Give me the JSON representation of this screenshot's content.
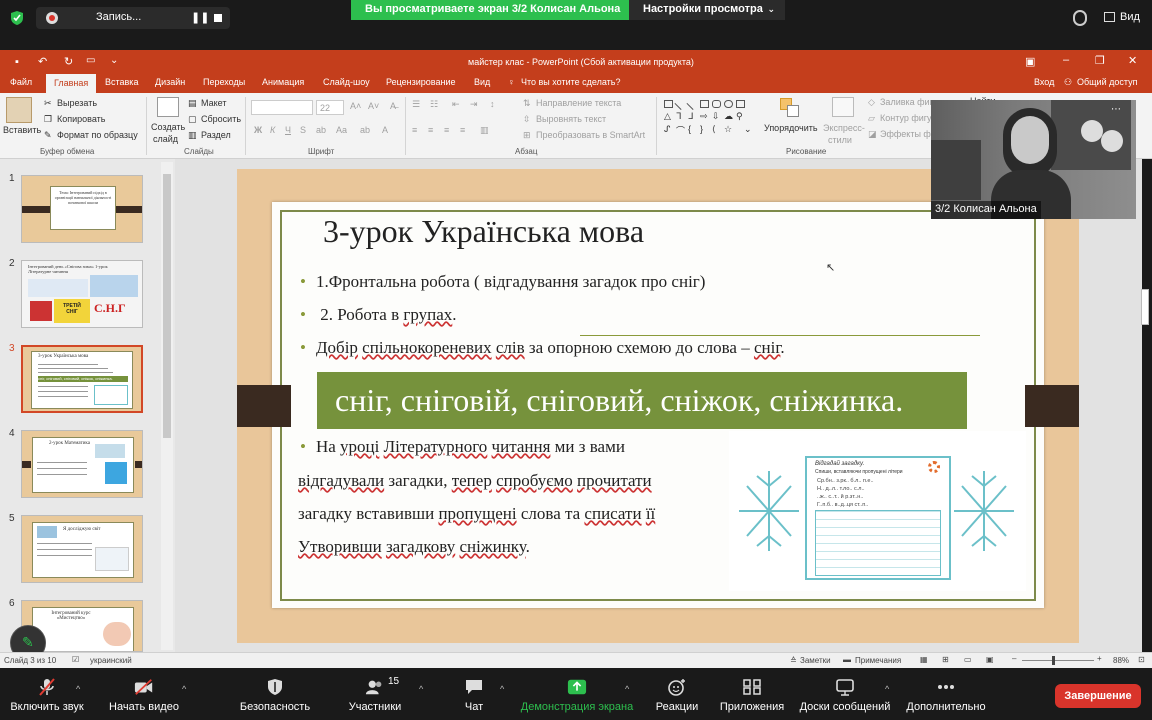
{
  "zoom": {
    "recording_label": "Запись...",
    "sharing_banner": "Вы просматриваете экран 3/2 Колисан Альона",
    "view_options": "Настройки просмотра",
    "view_label": "Вид",
    "participant_count": "15",
    "toolbar": [
      {
        "id": "mute",
        "label": "Включить звук"
      },
      {
        "id": "video",
        "label": "Начать видео"
      },
      {
        "id": "security",
        "label": "Безопасность"
      },
      {
        "id": "participants",
        "label": "Участники"
      },
      {
        "id": "chat",
        "label": "Чат"
      },
      {
        "id": "share",
        "label": "Демонстрация экрана"
      },
      {
        "id": "reactions",
        "label": "Реакции"
      },
      {
        "id": "apps",
        "label": "Приложения"
      },
      {
        "id": "whiteboards",
        "label": "Доски сообщений"
      },
      {
        "id": "more",
        "label": "Дополнительно"
      }
    ],
    "end_button": "Завершение",
    "video_name": "3/2 Колисан Альона",
    "share_color": "#2dbf4e",
    "end_color": "#d9342b"
  },
  "ppt": {
    "window_title": "майстер клас - PowerPoint (Сбой активации продукта)",
    "tabs": [
      "Файл",
      "Главная",
      "Вставка",
      "Дизайн",
      "Переходы",
      "Анимация",
      "Слайд-шоу",
      "Рецензирование",
      "Вид"
    ],
    "tell_me": "Что вы хотите сделать?",
    "signin": "Вход",
    "share": "Общий доступ",
    "ribbon": {
      "paste": "Вставить",
      "cut": "Вырезать",
      "copy": "Копировать",
      "format_painter": "Формат по образцу",
      "clipboard_group": "Буфер обмена",
      "new_slide": "Создать",
      "new_slide2": "слайд",
      "layout": "Макет",
      "reset": "Сбросить",
      "section": "Раздел",
      "slides_group": "Слайды",
      "font_size": "22",
      "font_group": "Шрифт",
      "bold": "Ж",
      "italic": "К",
      "underline": "Ч",
      "strike": "S",
      "text_direction": "Направление текста",
      "align_text": "Выровнять текст",
      "smartart": "Преобразовать в SmartArt",
      "paragraph_group": "Абзац",
      "arrange": "Упорядочить",
      "quick_styles": "Экспресс-",
      "quick_styles2": "стили",
      "shape_fill": "Заливка фигуры",
      "shape_outline": "Контур фигуры",
      "shape_effects": "Эффекты фигуры",
      "find": "Найти",
      "drawing_group": "Рисование"
    },
    "status": {
      "slide_info": "Слайд 3 из 10",
      "language": "украинский",
      "notes": "Заметки",
      "comments": "Примечания",
      "zoom": "88%"
    },
    "accent_color": "#c43e1c",
    "thumbnails": [
      {
        "num": "1",
        "title": "Тема: Інтегрований підхід в організації навчальної діяльності початкової школи"
      },
      {
        "num": "2",
        "title": "Інтегрований день «Снігова зима» 1-урок Літературне читання",
        "card1": "ТРЕТІЙ",
        "card2": "СНІГ",
        "letters": "С.Н.Г"
      },
      {
        "num": "3",
        "title": "3-урок Українська мова",
        "strip": "сніг, сніговий, сніговий, сніжок, сніжинка."
      },
      {
        "num": "4",
        "title": "2-урок Математика"
      },
      {
        "num": "5",
        "title": "Я досліджую світ"
      },
      {
        "num": "6",
        "title": "Інтегрований курс «Мистецтво»"
      }
    ]
  },
  "slide": {
    "title": "3-урок Українська мова",
    "bullet1": "1.Фронтальна робота ( відгадування загадок про сніг)",
    "bullet2_prefix": "2. Робота в ",
    "bullet2_u": "групах",
    "bullet2_suffix": ".",
    "bullet3_u1": "Добір",
    "bullet3_mid1": " ",
    "bullet3_u2": "спільнокореневих",
    "bullet3_mid2": " ",
    "bullet3_u3": "слів",
    "bullet3_mid3": " за опорною схемою до слова – ",
    "bullet3_u4": "сніг",
    "bullet3_end": ".",
    "green_strip": "сніг, сніговій, сніговий, сніжок, сніжинка.",
    "para_l1_a": "На ",
    "para_l1_u1": "уроці",
    "para_l1_b": " ",
    "para_l1_u2": "Літературного",
    "para_l1_c": " ",
    "para_l1_u3": "читання",
    "para_l1_d": " ми з вами",
    "para_l2_u1": "відгадували",
    "para_l2_a": " загадки, ",
    "para_l2_u2": "тепер",
    "para_l2_b": " ",
    "para_l2_u3": "спробуємо",
    "para_l2_c": " ",
    "para_l2_u4": "прочитати",
    "para_l3_a": "загадку вставивши ",
    "para_l3_u1": "пропущені",
    "para_l3_b": " слова та  ",
    "para_l3_u2": "списати",
    "para_l3_c": " ",
    "para_l3_u3": "її",
    "para_l4_u1": "Утворивши",
    "para_l4_a": " ",
    "para_l4_u2": "загадкову",
    "para_l4_b": " ",
    "para_l4_u3": "сніжинку",
    "para_l4_c": ".",
    "worksheet_title": "Відгадай загадку.",
    "worksheet_sub": "Спиши, вставляючи пропущені літери",
    "worksheet_lines": [
      "Ср.бн.. з.рк.. б.л.. п.е..",
      "Н.. д..л.. т.ло.. с.л..",
      "..ж.. с..т..  й р.зт..н..",
      "Г..п.б.. в..д..ця ст..п.."
    ],
    "green_color": "#76923c",
    "frame_color": "#e9c69a"
  }
}
